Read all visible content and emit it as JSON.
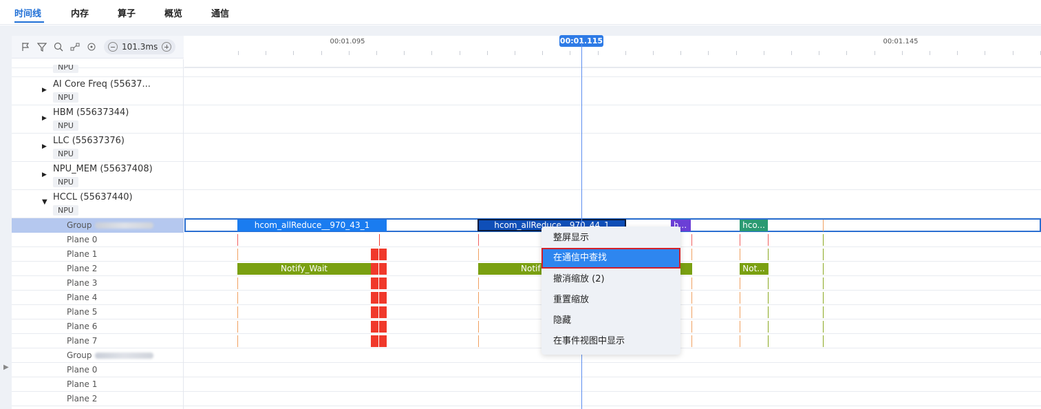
{
  "tabs": [
    {
      "label": "时间线",
      "active": true
    },
    {
      "label": "内存",
      "active": false
    },
    {
      "label": "算子",
      "active": false
    },
    {
      "label": "概览",
      "active": false
    },
    {
      "label": "通信",
      "active": false
    }
  ],
  "toolbar": {
    "icons": [
      "flag-icon",
      "filter-icon",
      "search-icon",
      "link-icon",
      "target-icon"
    ],
    "zoom_value": "101.3ms"
  },
  "ruler": {
    "labels": [
      "00:01.095",
      "00:01.145"
    ],
    "cursor_time": "00:01.115"
  },
  "tree": {
    "clipped_tag": "NPU",
    "processes": [
      {
        "name": "AI Core Freq (55637...",
        "tag": "NPU",
        "expanded": false
      },
      {
        "name": "HBM (55637344)",
        "tag": "NPU",
        "expanded": false
      },
      {
        "name": "LLC (55637376)",
        "tag": "NPU",
        "expanded": false
      },
      {
        "name": "NPU_MEM (55637408)",
        "tag": "NPU",
        "expanded": false
      },
      {
        "name": "HCCL (55637440)",
        "tag": "NPU",
        "expanded": true
      }
    ],
    "rows": [
      "Group",
      "Plane 0",
      "Plane 1",
      "Plane 2",
      "Plane 3",
      "Plane 4",
      "Plane 5",
      "Plane 6",
      "Plane 7",
      "Group",
      "Plane 0",
      "Plane 1",
      "Plane 2"
    ]
  },
  "blocks": {
    "group_a": "hcom_allReduce__970_43_1",
    "group_b": "hcom_allReduce__970_44_1",
    "group_c": "h...",
    "group_d": "hco...",
    "plane2_a": "Notify_Wait",
    "plane2_b": "Notif",
    "plane2_d": "Not..."
  },
  "context_menu": {
    "items": [
      "整屏显示",
      "在通信中查找",
      "撤消缩放 (2)",
      "重置缩放",
      "隐藏",
      "在事件视图中显示"
    ],
    "highlighted_index": 1
  },
  "colors": {
    "accent": "#1f6fd6",
    "block_blue": "#1a7cf0",
    "block_dark_blue": "#0f4fb8",
    "notify_green": "#7aa011",
    "purple": "#6b3fd6",
    "teal": "#2a9a72",
    "red": "#f0392b"
  }
}
